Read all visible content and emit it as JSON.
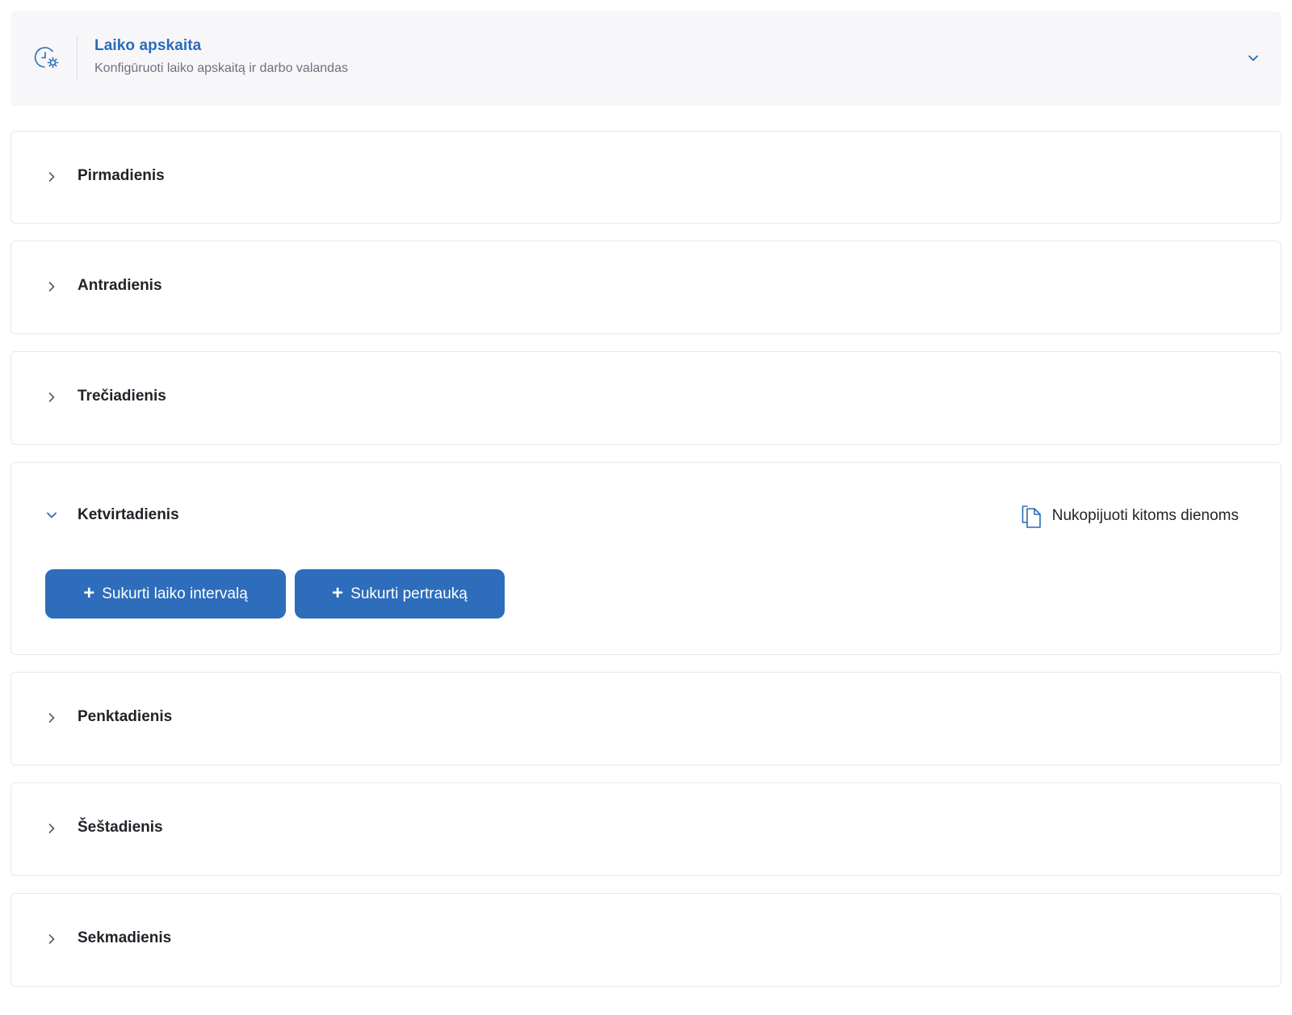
{
  "header": {
    "title": "Laiko apskaita",
    "subtitle": "Konfigūruoti laiko apskaitą ir darbo valandas",
    "icon": "clock-gear-icon"
  },
  "days": [
    {
      "label": "Pirmadienis",
      "expanded": false
    },
    {
      "label": "Antradienis",
      "expanded": false
    },
    {
      "label": "Trečiadienis",
      "expanded": false
    },
    {
      "label": "Ketvirtadienis",
      "expanded": true
    },
    {
      "label": "Penktadienis",
      "expanded": false
    },
    {
      "label": "Šeštadienis",
      "expanded": false
    },
    {
      "label": "Sekmadienis",
      "expanded": false
    }
  ],
  "expanded_day": {
    "copy_label": "Nukopijuoti kitoms dienoms",
    "create_interval_label": "Sukurti laiko intervalą",
    "create_break_label": "Sukurti pertrauką"
  },
  "colors": {
    "accent": "#2d6dbb",
    "title_blue": "#2a6bb8",
    "header_bg": "#f7f7f9",
    "border": "#e6e8eb"
  }
}
